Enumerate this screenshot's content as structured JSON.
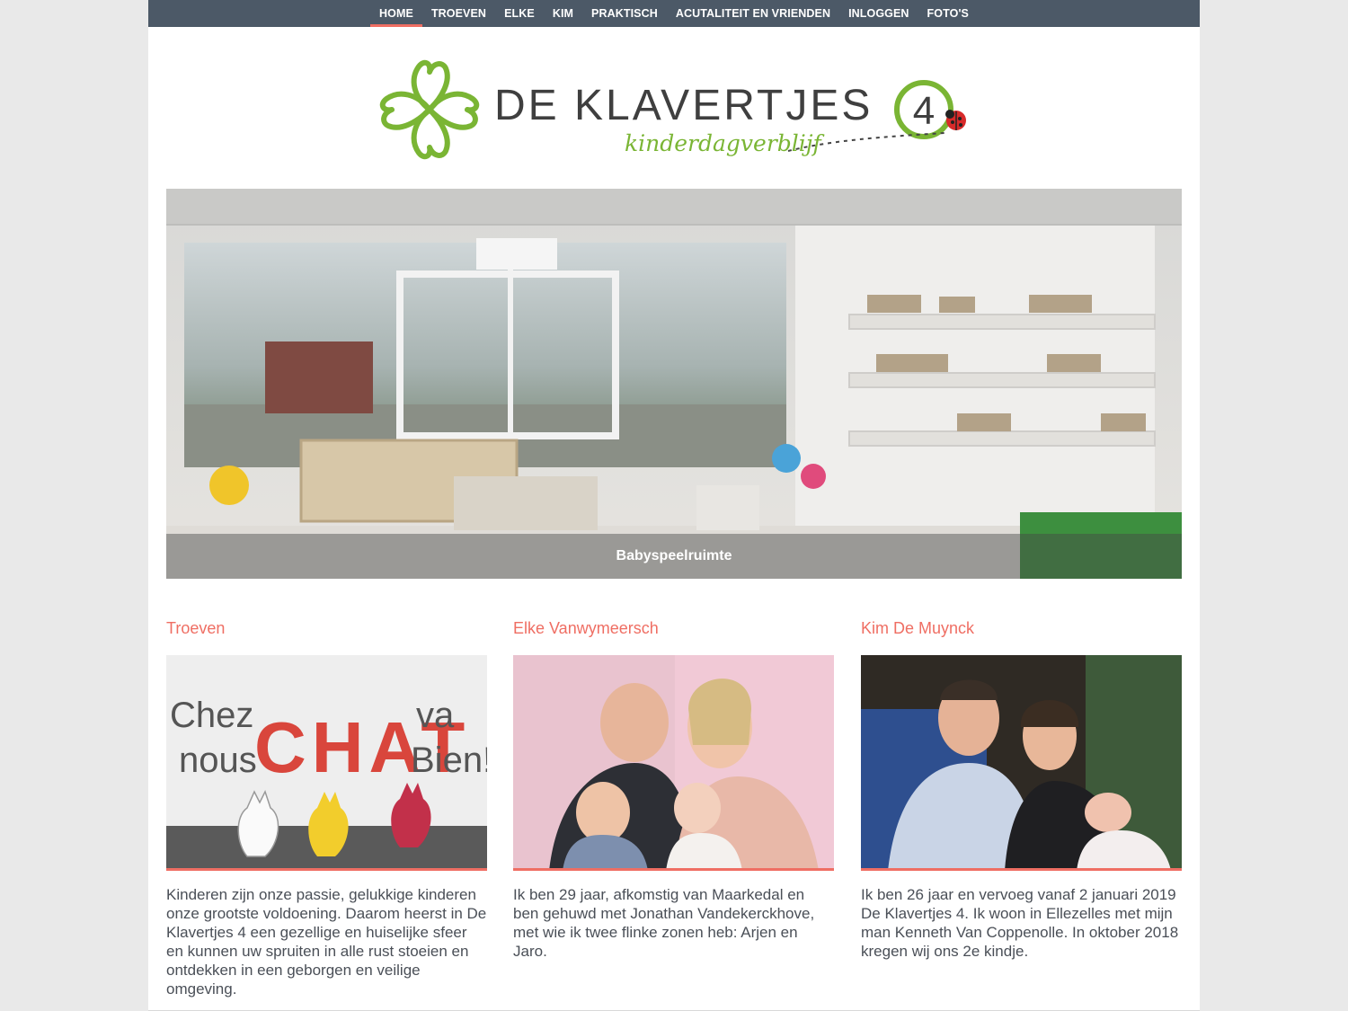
{
  "nav": {
    "items": [
      "HOME",
      "TROEVEN",
      "ELKE",
      "KIM",
      "PRAKTISCH",
      "ACUTALITEIT EN VRIENDEN",
      "INLOGGEN",
      "FOTO'S"
    ]
  },
  "logo": {
    "title": "DE KLAVERTJES",
    "number": "4",
    "subtitle": "kinderdagverblijf"
  },
  "hero": {
    "caption": "Babyspeelruimte"
  },
  "columns": [
    {
      "heading": "Troeven",
      "sign_line1_left": "Chez",
      "sign_letters": "CHAT",
      "sign_line1_right": "va",
      "sign_line2_left": "nous",
      "sign_line2_right": "Bien!",
      "text": "Kinderen zijn onze passie, gelukkige kinderen onze grootste voldoening. Daarom heerst in De Klavertjes 4 een gezellige en huiselijke sfeer en kunnen uw spruiten in alle rust stoeien en ontdekken in een geborgen en veilige omgeving."
    },
    {
      "heading": "Elke Vanwymeersch",
      "text": "Ik ben 29 jaar, afkomstig van Maarkedal en ben gehuwd met Jonathan Vandekerckhove, met wie ik twee flinke zonen heb: Arjen en Jaro."
    },
    {
      "heading": "Kim De Muynck",
      "text": "Ik ben 26 jaar en vervoeg vanaf 2 januari 2019 De Klavertjes 4. Ik woon in Ellezelles met mijn man Kenneth Van Coppenolle. In oktober 2018 kregen wij ons 2e kindje."
    }
  ],
  "colors": {
    "nav_bg": "#4c5967",
    "accent": "#ef6e63",
    "brand_green": "#7ab534",
    "text": "#4a4f57"
  }
}
